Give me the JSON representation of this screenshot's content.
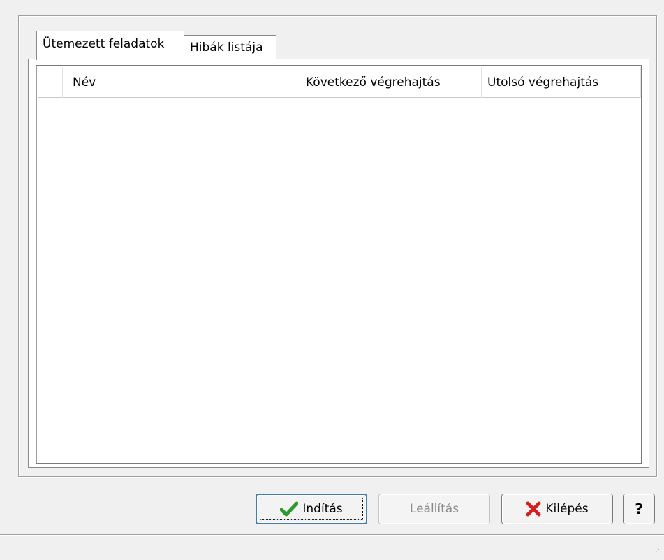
{
  "tabs": {
    "scheduled": "Ütemezett feladatok",
    "errors": "Hibák listája"
  },
  "table": {
    "columns": [
      "",
      "Név",
      "Következő végrehajtás",
      "Utolsó végrehajtás"
    ],
    "rows": []
  },
  "buttons": {
    "start": "Indítás",
    "stop": "Leállítás",
    "exit": "Kilépés",
    "help": "?"
  },
  "icons": {
    "start": "check-icon",
    "exit": "close-x-icon"
  },
  "colors": {
    "check_green": "#2c9b2c",
    "exit_red": "#d42020"
  }
}
